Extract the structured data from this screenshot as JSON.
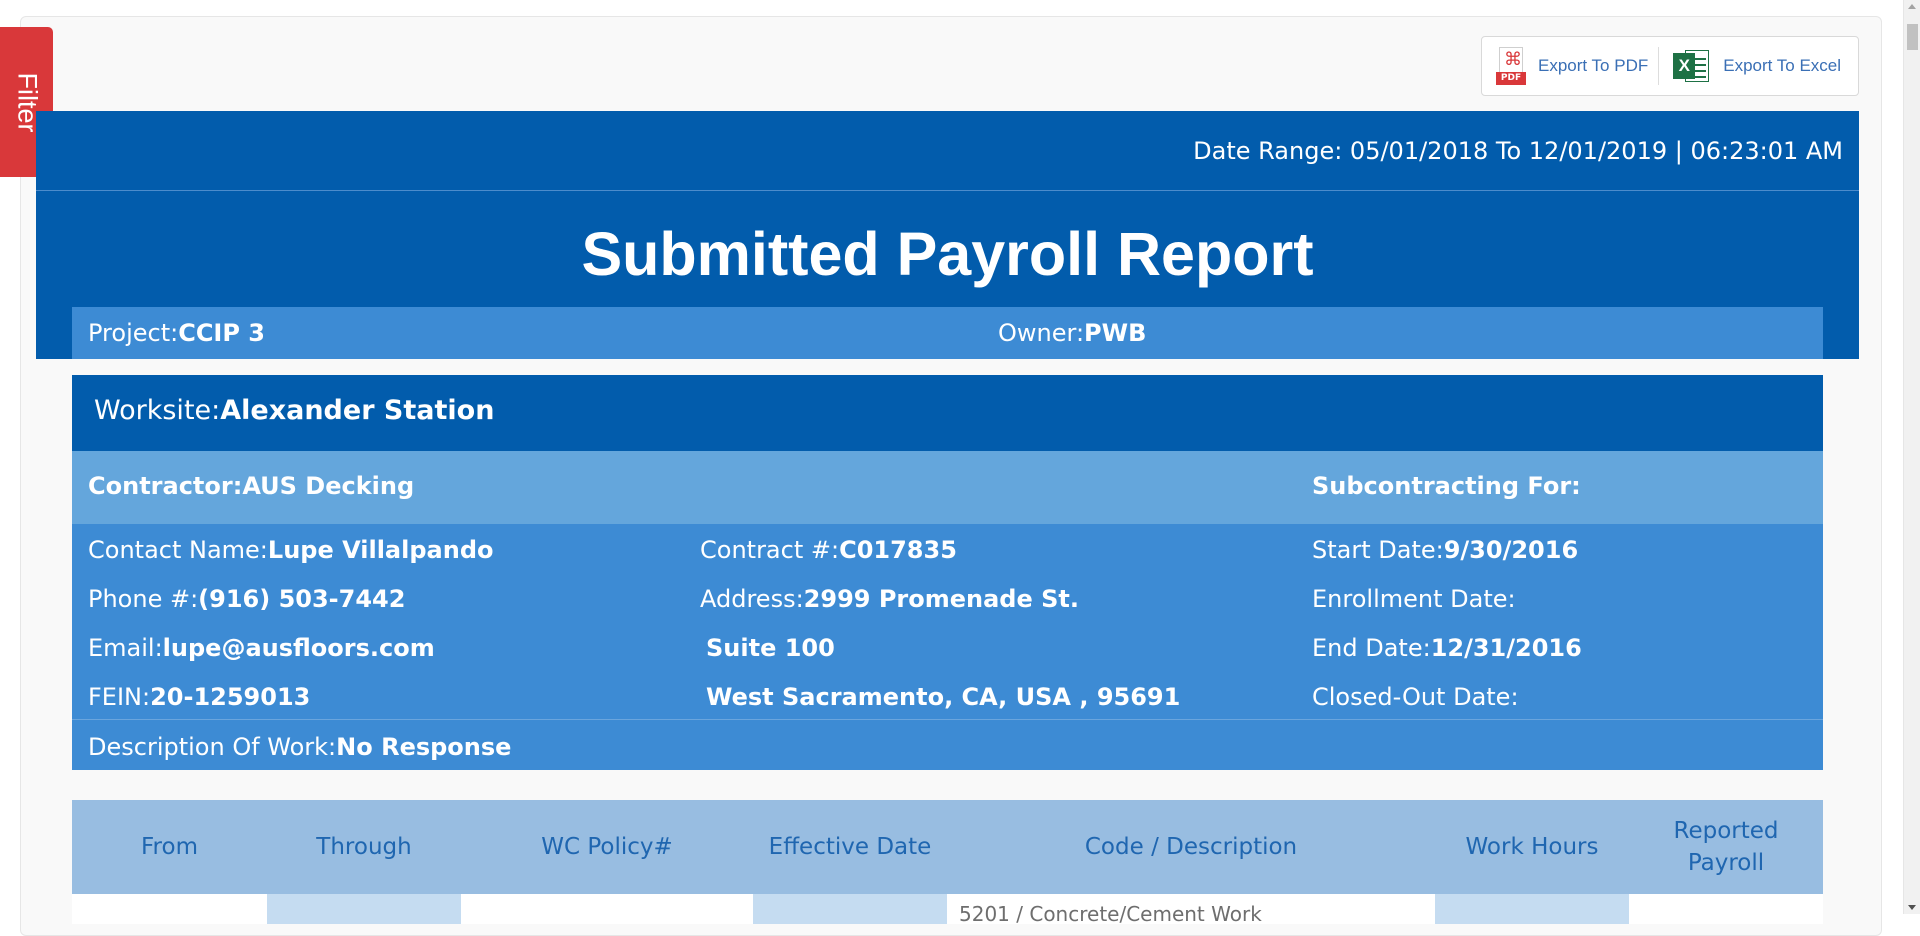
{
  "filter": {
    "label": "Filter"
  },
  "export": {
    "pdf_label": "Export To PDF",
    "pdf_icon_tag": "PDF",
    "excel_label": "Export To Excel",
    "excel_icon_glyph": "X"
  },
  "header": {
    "date_range": "Date Range: 05/01/2018 To 12/01/2019 | 06:23:01 AM",
    "title": "Submitted Payroll Report",
    "project_label": "Project:",
    "project_value": "CCIP 3",
    "owner_label": "Owner:",
    "owner_value": "PWB"
  },
  "worksite": {
    "label": "Worksite:",
    "value": "Alexander Station",
    "contractor_label": "Contractor:",
    "contractor_value": "AUS Decking",
    "subcontracting_label": "Subcontracting For:",
    "contact_label": "Contact Name:",
    "contact_value": "Lupe Villalpando",
    "phone_label": "Phone #:",
    "phone_value": "(916) 503-7442",
    "email_label": "Email:",
    "email_value": "lupe@ausfloors.com",
    "fein_label": "FEIN:",
    "fein_value": "20-1259013",
    "contract_label": "Contract #:",
    "contract_value": "C017835",
    "address_label": "Address:",
    "address_line1": "2999 Promenade St.",
    "address_line2": "Suite 100",
    "address_line3": "West Sacramento, CA, USA , 95691",
    "start_label": "Start Date:",
    "start_value": "9/30/2016",
    "enrollment_label": "Enrollment Date:",
    "end_label": "End Date:",
    "end_value": "12/31/2016",
    "closed_label": "Closed-Out Date:",
    "description_label": "Description Of Work:",
    "description_value": "No Response"
  },
  "table": {
    "headers": [
      "From",
      "Through",
      "WC Policy#",
      "Effective Date",
      "Code / Description",
      "Work Hours",
      "Reported Payroll"
    ],
    "first_row_partial": "5201 / Concrete/Cement Work"
  },
  "colors": {
    "header_blue": "#025cac",
    "light_blue": "#3d8bd4",
    "pale_blue": "#64a6dc",
    "table_head": "#98bde1",
    "filter_red": "#d9383a",
    "link_blue": "#3a6fb5",
    "excel_green": "#1e7145"
  },
  "icons": [
    "pdf-icon",
    "excel-icon"
  ]
}
